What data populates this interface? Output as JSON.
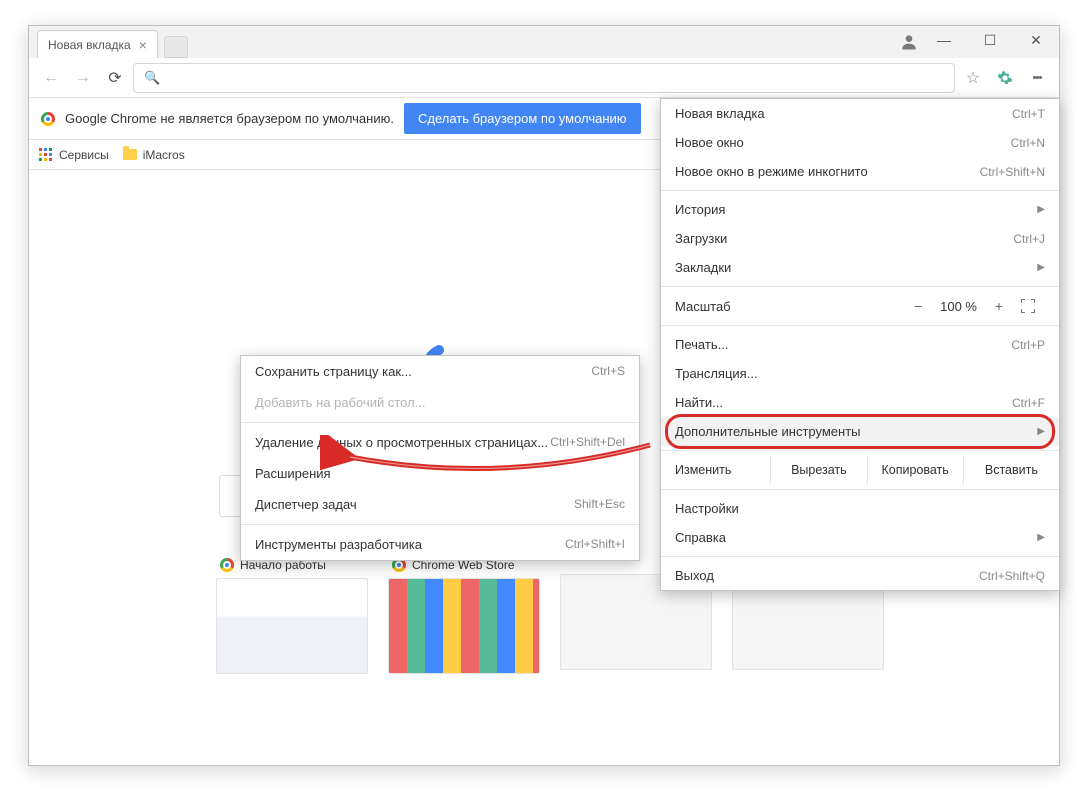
{
  "tab": {
    "title": "Новая вкладка"
  },
  "infobar": {
    "text": "Google Chrome не является браузером по умолчанию.",
    "button": "Сделать браузером по умолчанию"
  },
  "bookmarks": {
    "apps": "Сервисы",
    "folder1": "iMacros"
  },
  "menu": {
    "new_tab": "Новая вкладка",
    "new_tab_sc": "Ctrl+T",
    "new_window": "Новое окно",
    "new_window_sc": "Ctrl+N",
    "incognito": "Новое окно в режиме инкогнито",
    "incognito_sc": "Ctrl+Shift+N",
    "history": "История",
    "downloads": "Загрузки",
    "downloads_sc": "Ctrl+J",
    "bookmarks": "Закладки",
    "zoom_label": "Масштаб",
    "zoom_value": "100 %",
    "print": "Печать...",
    "print_sc": "Ctrl+P",
    "cast": "Трансляция...",
    "find": "Найти...",
    "find_sc": "Ctrl+F",
    "more_tools": "Дополнительные инструменты",
    "edit_label": "Изменить",
    "cut": "Вырезать",
    "copy": "Копировать",
    "paste": "Вставить",
    "settings": "Настройки",
    "help": "Справка",
    "exit": "Выход",
    "exit_sc": "Ctrl+Shift+Q"
  },
  "submenu": {
    "save_as": "Сохранить страницу как...",
    "save_as_sc": "Ctrl+S",
    "add_desktop": "Добавить на рабочий стол...",
    "clear_data": "Удаление данных о просмотренных страницах...",
    "clear_data_sc": "Ctrl+Shift+Del",
    "extensions": "Расширения",
    "task_mgr": "Диспетчер задач",
    "task_mgr_sc": "Shift+Esc",
    "dev_tools": "Инструменты разработчика",
    "dev_tools_sc": "Ctrl+Shift+I"
  },
  "thumbs": {
    "t1": "Начало работы",
    "t2": "Chrome Web Store"
  }
}
